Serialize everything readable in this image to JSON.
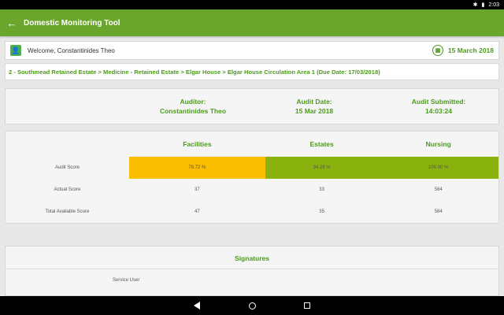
{
  "status_bar": {
    "time": "2:03",
    "bluetooth_icon": "bluetooth-icon",
    "battery_icon": "battery-icon"
  },
  "app_bar": {
    "title": "Domestic Monitoring Tool",
    "back_icon": "back-arrow-icon"
  },
  "welcome": {
    "text": "Welcome, Constantinides Theo",
    "date": "15 March 2018"
  },
  "breadcrumb": "2 - Southmead Retained Estate > Medicine - Retained Estate > Elgar House > Elgar House Circulation Area 1 (Due Date: 17/03/2018)",
  "summary": {
    "auditor_label": "Auditor:",
    "auditor_value": "Constantinides Theo",
    "date_label": "Audit Date:",
    "date_value": "15 Mar 2018",
    "submitted_label": "Audit Submitted:",
    "submitted_value": "14:03:24"
  },
  "scores": {
    "headers": [
      "",
      "Facilities",
      "Estates",
      "Nursing"
    ],
    "rows": [
      {
        "label": "Audit Score",
        "values": [
          "78.72 %",
          "94.29 %",
          "100.00 %"
        ]
      },
      {
        "label": "Actual Score",
        "values": [
          "37",
          "33",
          "584"
        ]
      },
      {
        "label": "Total Available Score",
        "values": [
          "47",
          "35",
          "584"
        ]
      }
    ],
    "colors": {
      "amber": "#fbbd00",
      "green": "#89b20e"
    }
  },
  "signatures": {
    "title": "Signatures",
    "service_user_label": "Service User"
  },
  "colors": {
    "primary": "#6aa52c",
    "accent_text": "#4c9a1c"
  }
}
